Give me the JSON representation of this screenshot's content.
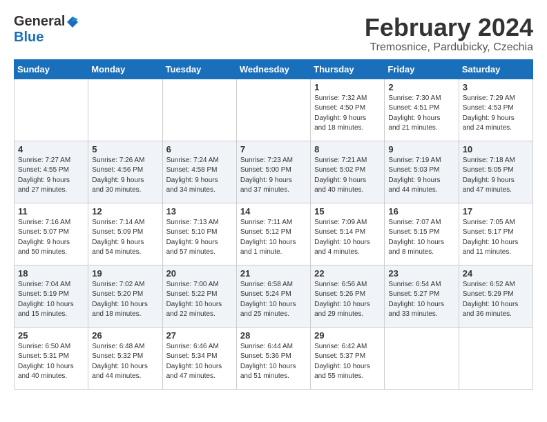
{
  "logo": {
    "general": "General",
    "blue": "Blue"
  },
  "title": "February 2024",
  "location": "Tremosnice, Pardubicky, Czechia",
  "days_of_week": [
    "Sunday",
    "Monday",
    "Tuesday",
    "Wednesday",
    "Thursday",
    "Friday",
    "Saturday"
  ],
  "weeks": [
    [
      {
        "day": "",
        "info": ""
      },
      {
        "day": "",
        "info": ""
      },
      {
        "day": "",
        "info": ""
      },
      {
        "day": "",
        "info": ""
      },
      {
        "day": "1",
        "info": "Sunrise: 7:32 AM\nSunset: 4:50 PM\nDaylight: 9 hours\nand 18 minutes."
      },
      {
        "day": "2",
        "info": "Sunrise: 7:30 AM\nSunset: 4:51 PM\nDaylight: 9 hours\nand 21 minutes."
      },
      {
        "day": "3",
        "info": "Sunrise: 7:29 AM\nSunset: 4:53 PM\nDaylight: 9 hours\nand 24 minutes."
      }
    ],
    [
      {
        "day": "4",
        "info": "Sunrise: 7:27 AM\nSunset: 4:55 PM\nDaylight: 9 hours\nand 27 minutes."
      },
      {
        "day": "5",
        "info": "Sunrise: 7:26 AM\nSunset: 4:56 PM\nDaylight: 9 hours\nand 30 minutes."
      },
      {
        "day": "6",
        "info": "Sunrise: 7:24 AM\nSunset: 4:58 PM\nDaylight: 9 hours\nand 34 minutes."
      },
      {
        "day": "7",
        "info": "Sunrise: 7:23 AM\nSunset: 5:00 PM\nDaylight: 9 hours\nand 37 minutes."
      },
      {
        "day": "8",
        "info": "Sunrise: 7:21 AM\nSunset: 5:02 PM\nDaylight: 9 hours\nand 40 minutes."
      },
      {
        "day": "9",
        "info": "Sunrise: 7:19 AM\nSunset: 5:03 PM\nDaylight: 9 hours\nand 44 minutes."
      },
      {
        "day": "10",
        "info": "Sunrise: 7:18 AM\nSunset: 5:05 PM\nDaylight: 9 hours\nand 47 minutes."
      }
    ],
    [
      {
        "day": "11",
        "info": "Sunrise: 7:16 AM\nSunset: 5:07 PM\nDaylight: 9 hours\nand 50 minutes."
      },
      {
        "day": "12",
        "info": "Sunrise: 7:14 AM\nSunset: 5:09 PM\nDaylight: 9 hours\nand 54 minutes."
      },
      {
        "day": "13",
        "info": "Sunrise: 7:13 AM\nSunset: 5:10 PM\nDaylight: 9 hours\nand 57 minutes."
      },
      {
        "day": "14",
        "info": "Sunrise: 7:11 AM\nSunset: 5:12 PM\nDaylight: 10 hours\nand 1 minute."
      },
      {
        "day": "15",
        "info": "Sunrise: 7:09 AM\nSunset: 5:14 PM\nDaylight: 10 hours\nand 4 minutes."
      },
      {
        "day": "16",
        "info": "Sunrise: 7:07 AM\nSunset: 5:15 PM\nDaylight: 10 hours\nand 8 minutes."
      },
      {
        "day": "17",
        "info": "Sunrise: 7:05 AM\nSunset: 5:17 PM\nDaylight: 10 hours\nand 11 minutes."
      }
    ],
    [
      {
        "day": "18",
        "info": "Sunrise: 7:04 AM\nSunset: 5:19 PM\nDaylight: 10 hours\nand 15 minutes."
      },
      {
        "day": "19",
        "info": "Sunrise: 7:02 AM\nSunset: 5:20 PM\nDaylight: 10 hours\nand 18 minutes."
      },
      {
        "day": "20",
        "info": "Sunrise: 7:00 AM\nSunset: 5:22 PM\nDaylight: 10 hours\nand 22 minutes."
      },
      {
        "day": "21",
        "info": "Sunrise: 6:58 AM\nSunset: 5:24 PM\nDaylight: 10 hours\nand 25 minutes."
      },
      {
        "day": "22",
        "info": "Sunrise: 6:56 AM\nSunset: 5:26 PM\nDaylight: 10 hours\nand 29 minutes."
      },
      {
        "day": "23",
        "info": "Sunrise: 6:54 AM\nSunset: 5:27 PM\nDaylight: 10 hours\nand 33 minutes."
      },
      {
        "day": "24",
        "info": "Sunrise: 6:52 AM\nSunset: 5:29 PM\nDaylight: 10 hours\nand 36 minutes."
      }
    ],
    [
      {
        "day": "25",
        "info": "Sunrise: 6:50 AM\nSunset: 5:31 PM\nDaylight: 10 hours\nand 40 minutes."
      },
      {
        "day": "26",
        "info": "Sunrise: 6:48 AM\nSunset: 5:32 PM\nDaylight: 10 hours\nand 44 minutes."
      },
      {
        "day": "27",
        "info": "Sunrise: 6:46 AM\nSunset: 5:34 PM\nDaylight: 10 hours\nand 47 minutes."
      },
      {
        "day": "28",
        "info": "Sunrise: 6:44 AM\nSunset: 5:36 PM\nDaylight: 10 hours\nand 51 minutes."
      },
      {
        "day": "29",
        "info": "Sunrise: 6:42 AM\nSunset: 5:37 PM\nDaylight: 10 hours\nand 55 minutes."
      },
      {
        "day": "",
        "info": ""
      },
      {
        "day": "",
        "info": ""
      }
    ]
  ]
}
